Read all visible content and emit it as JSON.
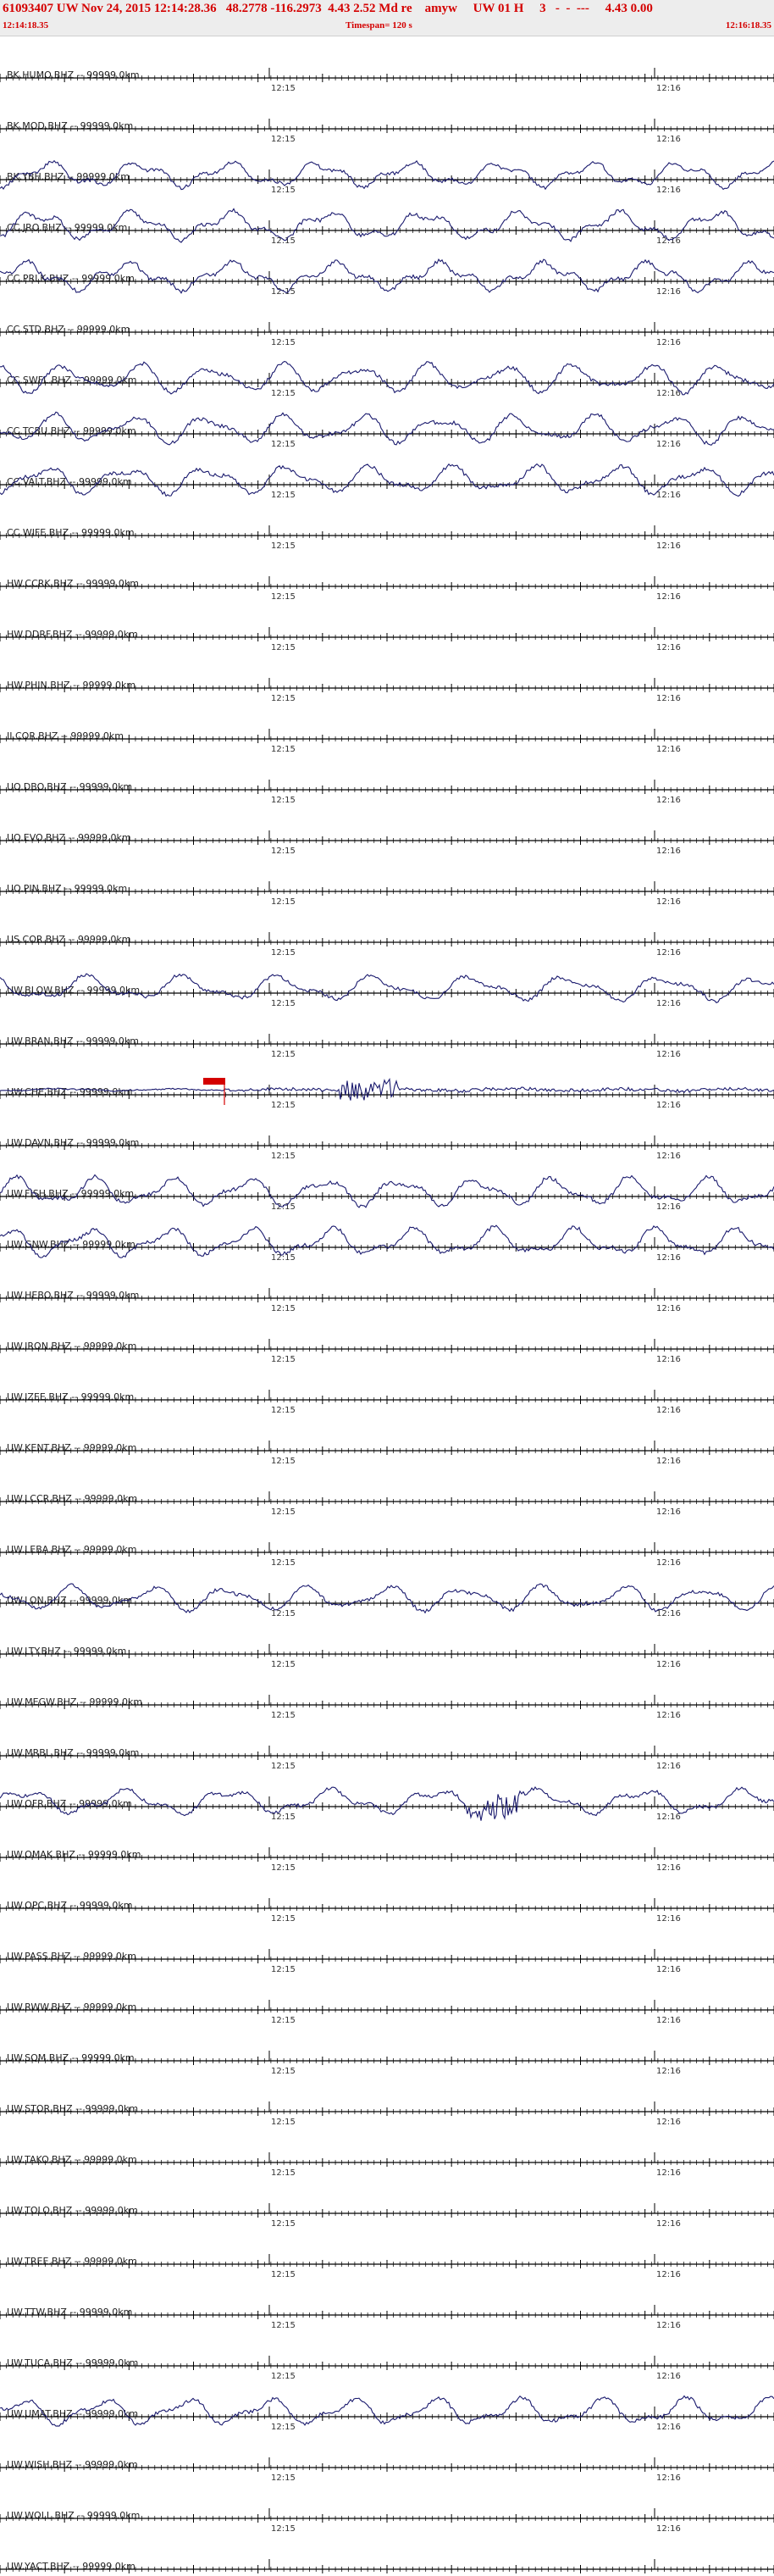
{
  "header": {
    "title": "61093407 UW Nov 24, 2015 12:14:28.36   48.2778 -116.2973  4.43 2.52 Md re    amyw     UW 01 H     3   -  -  ---     4.43 0.00",
    "start_time": "12:14:18.35",
    "timespan": "Timespan= 120 s",
    "end_time": "12:16:18.35"
  },
  "colors": {
    "text_red": "#d40000",
    "trace": "#1a1a6e",
    "axis": "#000000",
    "pick": "#d40000"
  },
  "chart_data": {
    "type": "line",
    "title": "",
    "time_ticks": [
      "12:15",
      "12:16"
    ],
    "pick_trace": "UW.CHE.BHZ",
    "stations": [
      {
        "label": "BK.HUMO.BHZ -- 99999.0km",
        "amp": 0
      },
      {
        "label": "BK.MOD.BHZ -- 99999.0km",
        "amp": 0
      },
      {
        "label": "BK.YBH.BHZ -- 99999.0km",
        "amp": 0.8
      },
      {
        "label": "CC.JRO.BHZ -- 99999.0km",
        "amp": 0.9
      },
      {
        "label": "CC.PRLK.BHZ -- 99999.0km",
        "amp": 0.9
      },
      {
        "label": "CC.STD.BHZ -- 99999.0km",
        "amp": 0
      },
      {
        "label": "CC.SWFL.BHZ -- 99999.0km",
        "amp": 0.9
      },
      {
        "label": "CC.TCBU.BHZ -- 99999.0km",
        "amp": 0.9
      },
      {
        "label": "CC.VALT.BHZ -- 99999.0km",
        "amp": 0.9
      },
      {
        "label": "CC.WIFE.BHZ -- 99999.0km",
        "amp": 0
      },
      {
        "label": "HW.CCRK.BHZ -- 99999.0km",
        "amp": 0
      },
      {
        "label": "HW.DDRF.BHZ -- 99999.0km",
        "amp": 0
      },
      {
        "label": "HW.PHIN.BHZ -- 99999.0km",
        "amp": 0
      },
      {
        "label": "II.COR.BHZ -- 99999.0km",
        "amp": 0
      },
      {
        "label": "UO.DBO.BHZ -- 99999.0km",
        "amp": 0
      },
      {
        "label": "UO.EVO.BHZ -- 99999.0km",
        "amp": 0
      },
      {
        "label": "UO.PIN.BHZ -- 99999.0km",
        "amp": 0
      },
      {
        "label": "US.COR.BHZ -- 99999.0km",
        "amp": 0
      },
      {
        "label": "UW.BLOW.BHZ -- 99999.0km",
        "amp": 0.8
      },
      {
        "label": "UW.BRAN.BHZ -- 99999.0km",
        "amp": 0
      },
      {
        "label": "UW.CHE.BHZ -- 99999.0km",
        "amp": 0.35
      },
      {
        "label": "UW.DAVN.BHZ -- 99999.0km",
        "amp": 0
      },
      {
        "label": "UW.FISH.BHZ -- 99999.0km",
        "amp": 0.9
      },
      {
        "label": "UW.GNW.BHZ -- 99999.0km",
        "amp": 0.9
      },
      {
        "label": "UW.HEBO.BHZ -- 99999.0km",
        "amp": 0
      },
      {
        "label": "UW.IRON.BHZ -- 99999.0km",
        "amp": 0
      },
      {
        "label": "UW.IZEE.BHZ -- 99999.0km",
        "amp": 0
      },
      {
        "label": "UW.KENT.BHZ -- 99999.0km",
        "amp": 0
      },
      {
        "label": "UW.LCCR.BHZ -- 99999.0km",
        "amp": 0
      },
      {
        "label": "UW.LEBA.BHZ -- 99999.0km",
        "amp": 0
      },
      {
        "label": "UW.LON.BHZ -- 99999.0km",
        "amp": 0.8
      },
      {
        "label": "UW.LTY.BHZ -- 99999.0km",
        "amp": 0
      },
      {
        "label": "UW.MEGW.BHZ -- 99999.0km",
        "amp": 0
      },
      {
        "label": "UW.MRBL.BHZ -- 99999.0km",
        "amp": 0
      },
      {
        "label": "UW.OFR.BHZ -- 99999.0km",
        "amp": 0.8
      },
      {
        "label": "UW.OMAK.BHZ -- 99999.0km",
        "amp": 0
      },
      {
        "label": "UW.OPC.BHZ -- 99999.0km",
        "amp": 0
      },
      {
        "label": "UW.PASS.BHZ -- 99999.0km",
        "amp": 0
      },
      {
        "label": "UW.RWW.BHZ -- 99999.0km",
        "amp": 0
      },
      {
        "label": "UW.SQM.BHZ -- 99999.0km",
        "amp": 0
      },
      {
        "label": "UW.STOR.BHZ -- 99999.0km",
        "amp": 0
      },
      {
        "label": "UW.TAKO.BHZ -- 99999.0km",
        "amp": 0
      },
      {
        "label": "UW.TOLO.BHZ -- 99999.0km",
        "amp": 0
      },
      {
        "label": "UW.TREE.BHZ -- 99999.0km",
        "amp": 0
      },
      {
        "label": "UW.TTW.BHZ -- 99999.0km",
        "amp": 0
      },
      {
        "label": "UW.TUCA.BHZ -- 99999.0km",
        "amp": 0
      },
      {
        "label": "UW.UMAT.BHZ -- 99999.0km",
        "amp": 0.85
      },
      {
        "label": "UW.WISH.BHZ -- 99999.0km",
        "amp": 0
      },
      {
        "label": "UW.WOLL.BHZ -- 99999.0km",
        "amp": 0
      },
      {
        "label": "UW.YACT.BHZ -- 99999.0km",
        "amp": 0
      }
    ]
  }
}
